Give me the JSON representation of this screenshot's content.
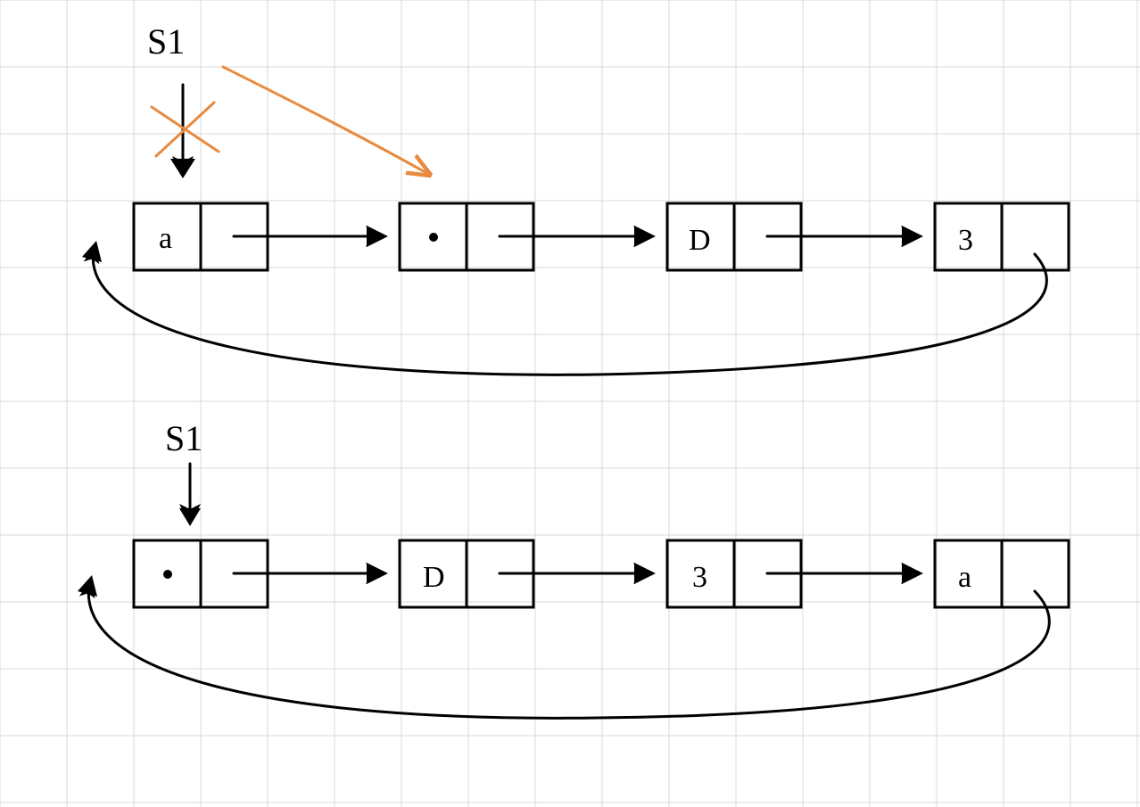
{
  "top": {
    "pointer_label": "S1",
    "nodes": [
      "a",
      "·",
      "D",
      "3"
    ]
  },
  "bottom": {
    "pointer_label": "S1",
    "nodes": [
      "·",
      "D",
      "3",
      "a"
    ]
  },
  "description": "Two circular singly-linked lists of 4 cons-cells. Top list order a→·→D→3→(back to a); S1 originally points at 'a' (crossed out) and an orange arrow redirects it to '·'. Bottom list order ·→D→3→a→(back to ·); S1 points at '·'."
}
